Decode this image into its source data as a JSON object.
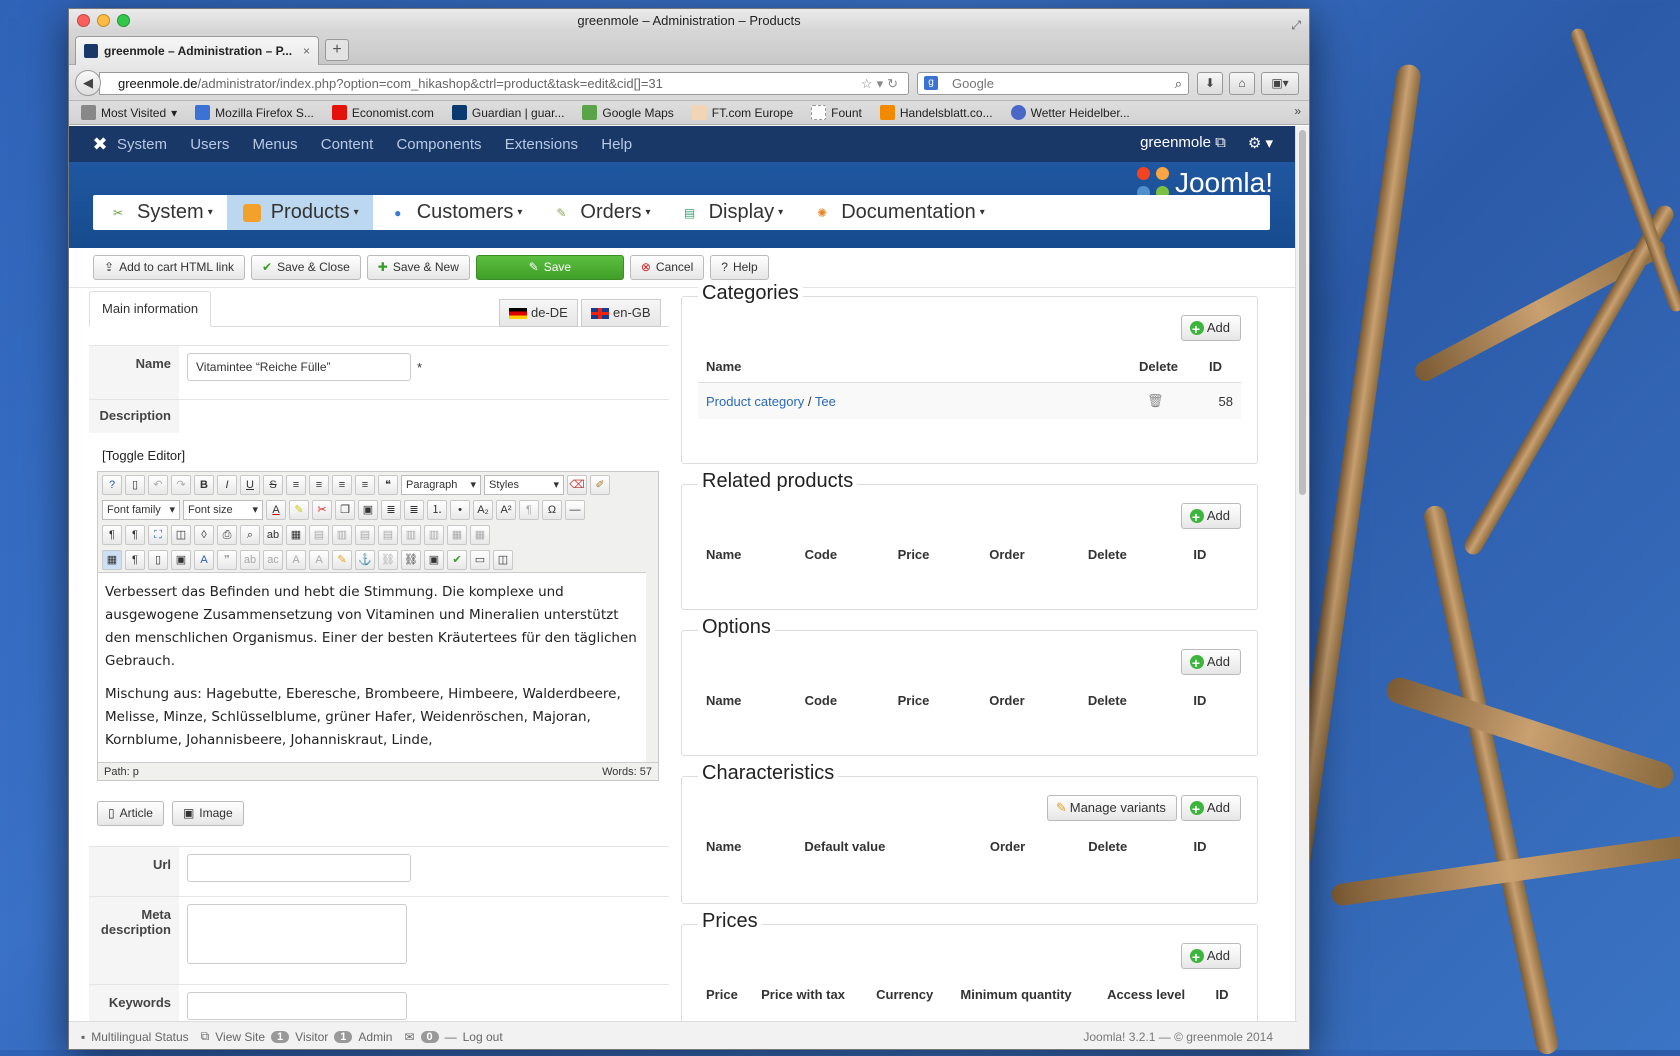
{
  "window": {
    "title": "greenmole – Administration – Products"
  },
  "tab": {
    "title": "greenmole – Administration – P..."
  },
  "url": {
    "domain": "greenmole.de",
    "path": "/administrator/index.php?option=com_hikashop&ctrl=product&task=edit&cid[]=31"
  },
  "search": {
    "placeholder": "Google"
  },
  "bookmarks": [
    {
      "label": "Most Visited",
      "color": "#888"
    },
    {
      "label": "Mozilla Firefox S...",
      "color": "#3b73d4"
    },
    {
      "label": "Economist.com",
      "color": "#e3120b"
    },
    {
      "label": "Guardian | guar...",
      "color": "#0b3a6e"
    },
    {
      "label": "Google Maps",
      "color": "#5aa349"
    },
    {
      "label": "FT.com Europe",
      "color": "#f2d5b5"
    },
    {
      "label": "Fount",
      "color": "#bbb"
    },
    {
      "label": "Handelsblatt.co...",
      "color": "#f28a00"
    },
    {
      "label": "Wetter Heidelber...",
      "color": "#4b67c8"
    }
  ],
  "admin_menu": {
    "items": [
      "System",
      "Users",
      "Menus",
      "Content",
      "Components",
      "Extensions",
      "Help"
    ],
    "user": "greenmole"
  },
  "brand": {
    "logo_text": "Joomla!"
  },
  "hika_nav": [
    {
      "label": "System",
      "color": "#6a9a3a"
    },
    {
      "label": "Products",
      "color": "#f2a22c"
    },
    {
      "label": "Customers",
      "color": "#3a7bd0"
    },
    {
      "label": "Orders",
      "color": "#8aa65a"
    },
    {
      "label": "Display",
      "color": "#3aa070"
    },
    {
      "label": "Documentation",
      "color": "#e6882a"
    }
  ],
  "toolbar": {
    "add_cart": "Add to cart HTML link",
    "save_close": "Save & Close",
    "save_new": "Save & New",
    "save": "Save",
    "cancel": "Cancel",
    "help": "Help"
  },
  "main_tab": "Main information",
  "languages": [
    "de-DE",
    "en-GB"
  ],
  "form": {
    "name_label": "Name",
    "name_value": "Vitamintee “Reiche Fülle”",
    "required_mark": "*",
    "description_label": "Description",
    "toggle_editor": "[Toggle Editor]",
    "editor": {
      "paragraph_select": "Paragraph",
      "styles_select": "Styles",
      "font_family_select": "Font family",
      "font_size_select": "Font size",
      "content_p1": "Verbessert das Befinden und hebt die Stimmung. Die komplexe und ausgewogene Zusammensetzung von Vitaminen und Mineralien unterstützt den menschlichen Organismus. Einer der besten Kräutertees für den täglichen Gebrauch.",
      "content_p2": "Mischung aus: Hagebutte, Eberesche, Brombeere, Himbeere, Walderdbeere, Melisse, Minze, Schlüsselblume, grüner Hafer, Weidenröschen, Majoran, Kornblume, Johannisbeere, Johanniskraut, Linde,",
      "path": "Path:  p",
      "words": "Words: 57"
    },
    "article_button": "Article",
    "image_button": "Image",
    "url_label": "Url",
    "meta_label": "Meta description",
    "keywords_label": "Keywords"
  },
  "categories": {
    "title": "Categories",
    "add": "Add",
    "headers": [
      "Name",
      "Delete",
      "ID"
    ],
    "row": {
      "parent": "Product category",
      "sep": " / ",
      "child": "Tee",
      "id": "58"
    }
  },
  "related": {
    "title": "Related products",
    "add": "Add",
    "headers": [
      "Name",
      "Code",
      "Price",
      "Order",
      "Delete",
      "ID"
    ]
  },
  "options": {
    "title": "Options",
    "add": "Add",
    "headers": [
      "Name",
      "Code",
      "Price",
      "Order",
      "Delete",
      "ID"
    ]
  },
  "characteristics": {
    "title": "Characteristics",
    "manage": "Manage variants",
    "add": "Add",
    "headers": [
      "Name",
      "Default value",
      "Order",
      "Delete",
      "ID"
    ]
  },
  "prices": {
    "title": "Prices",
    "add": "Add",
    "headers": [
      "Price",
      "Price with tax",
      "Currency",
      "Minimum quantity",
      "Access level",
      "ID"
    ]
  },
  "status": {
    "multilingual": "Multilingual Status",
    "view_site": "View Site",
    "visitor_count": "1",
    "visitor": "Visitor",
    "admin_count": "1",
    "admin": "Admin",
    "msg_count": "0",
    "logout": "Log out",
    "version": "Joomla! 3.2.1  —  © greenmole 2014"
  }
}
